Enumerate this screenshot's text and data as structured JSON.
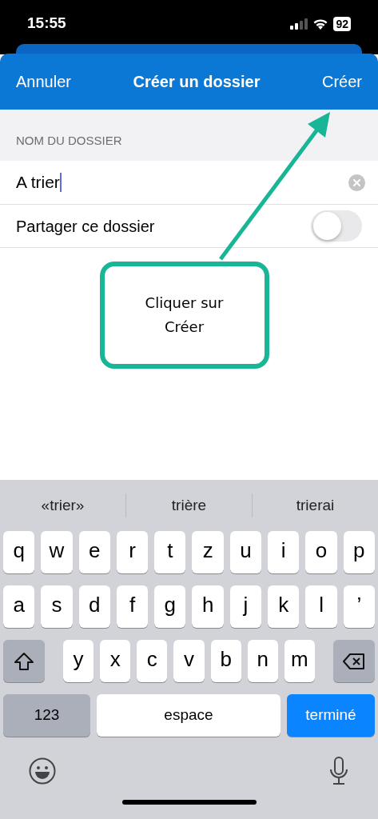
{
  "status_bar": {
    "time": "15:55",
    "battery": "92"
  },
  "header": {
    "cancel": "Annuler",
    "title": "Créer un dossier",
    "confirm": "Créer"
  },
  "section_label": "NOM DU DOSSIER",
  "name_field": {
    "value": "A trier"
  },
  "share_toggle": {
    "label": "Partager ce dossier",
    "on": false
  },
  "callout": {
    "text": "Cliquer sur Créer"
  },
  "keyboard": {
    "suggestions": [
      "«trier»",
      "trière",
      "trierai"
    ],
    "rows": [
      [
        "q",
        "w",
        "e",
        "r",
        "t",
        "z",
        "u",
        "i",
        "o",
        "p"
      ],
      [
        "a",
        "s",
        "d",
        "f",
        "g",
        "h",
        "j",
        "k",
        "l",
        "’"
      ],
      [
        "y",
        "x",
        "c",
        "v",
        "b",
        "n",
        "m"
      ]
    ],
    "numbers_key": "123",
    "space_key": "espace",
    "return_key": "terminé"
  }
}
